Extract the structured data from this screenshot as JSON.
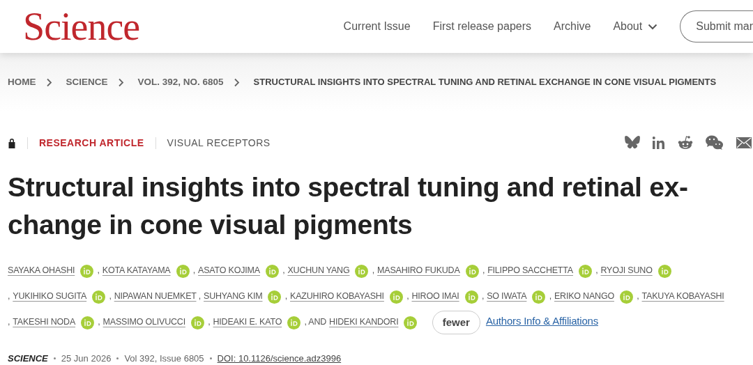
{
  "header": {
    "logo": "Science",
    "nav": [
      {
        "label": "Current Issue",
        "dropdown": false
      },
      {
        "label": "First release papers",
        "dropdown": false
      },
      {
        "label": "Archive",
        "dropdown": false
      },
      {
        "label": "About",
        "dropdown": true
      }
    ],
    "submit_button": "Submit mar"
  },
  "breadcrumbs": [
    {
      "label": "HOME",
      "current": false
    },
    {
      "label": "SCIENCE",
      "current": false
    },
    {
      "label": "VOL. 392, NO. 6805",
      "current": false
    },
    {
      "label": "STRUCTURAL INSIGHTS INTO SPECTRAL TUNING AND RETINAL EXCHANGE IN CONE VISUAL PIGMENTS",
      "current": true
    }
  ],
  "article": {
    "locked": true,
    "type": "RESEARCH ARTICLE",
    "topic": "VISUAL RECEPTORS",
    "title": "Structural insights into spectral tuning and retinal ex-change in cone visual pigments",
    "authors": [
      {
        "name": "SAYAKA OHASHI",
        "orcid": true
      },
      {
        "before": ",",
        "name": "KOTA KATAYAMA",
        "orcid": true
      },
      {
        "before": ",",
        "name": "ASATO KOJIMA",
        "orcid": true
      },
      {
        "before": ",",
        "name": "XUCHUN YANG",
        "orcid": true
      },
      {
        "before": ",",
        "name": "MASAHIRO FUKUDA",
        "orcid": true
      },
      {
        "before": ",",
        "name": "FILIPPO SACCHETTA",
        "orcid": true
      },
      {
        "before": ",",
        "name": "RYOJI SUNO",
        "orcid": true
      },
      {
        "before": ",",
        "name": "YUKIHIKO SUGITA",
        "orcid": true
      },
      {
        "before": ",",
        "name": "NIPAWAN NUEMKET",
        "orcid": false
      },
      {
        "before": ",",
        "name": "SUHYANG KIM",
        "orcid": true
      },
      {
        "before": ",",
        "name": "KAZUHIRO KOBAYASHI",
        "orcid": true
      },
      {
        "before": ",",
        "name": "HIROO IMAI",
        "orcid": true
      },
      {
        "before": ",",
        "name": "SO IWATA",
        "orcid": true
      },
      {
        "before": ",",
        "name": "ERIKO NANGO",
        "orcid": true
      },
      {
        "before": ",",
        "name": "TAKUYA KOBAYASHI",
        "orcid": false
      },
      {
        "before": ",",
        "name": "TAKESHI NODA",
        "orcid": true
      },
      {
        "before": ",",
        "name": "MASSIMO OLIVUCCI",
        "orcid": true
      },
      {
        "before": ",",
        "name": "HIDEAKI E. KATO",
        "orcid": true
      },
      {
        "before": ", AND",
        "name": "HIDEKI KANDORI",
        "orcid": true
      }
    ],
    "fewer_button": "fewer",
    "affiliations_link": "Authors Info & Affiliations",
    "meta": {
      "journal": "SCIENCE",
      "date": "25 Jun 2026",
      "volume": "Vol 392, Issue 6805",
      "doi": "DOI: 10.1126/science.adz3996"
    }
  }
}
